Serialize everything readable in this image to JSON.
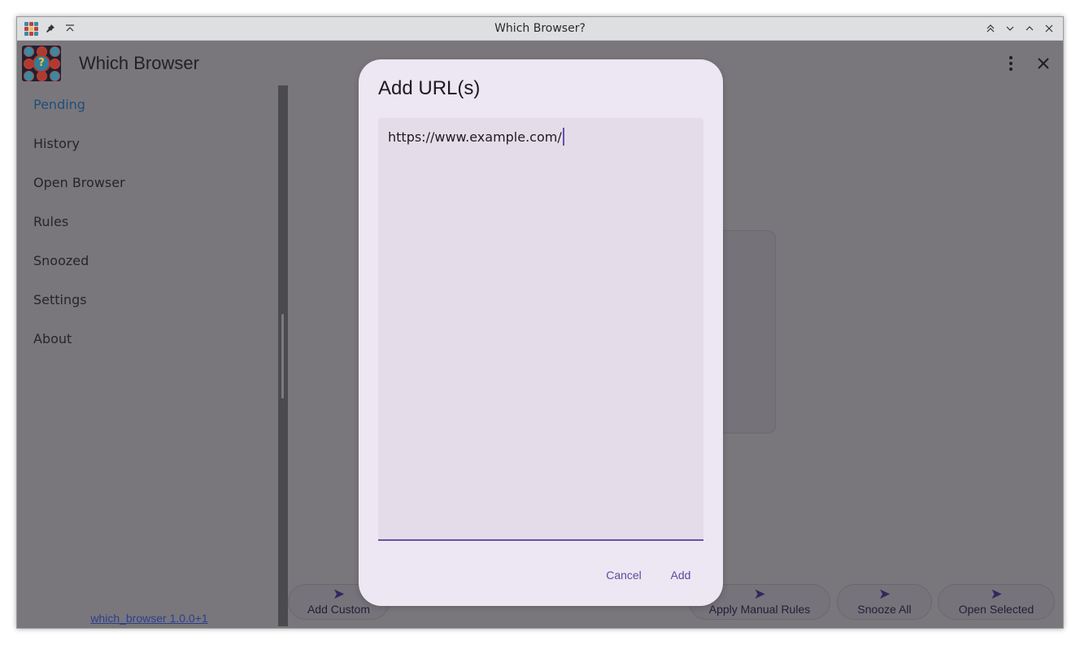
{
  "window": {
    "title": "Which Browser?"
  },
  "app": {
    "title": "Which Browser",
    "version": "which_browser 1.0.0+1"
  },
  "sidebar": {
    "items": [
      {
        "label": "Pending",
        "active": true
      },
      {
        "label": "History",
        "active": false
      },
      {
        "label": "Open Browser",
        "active": false
      },
      {
        "label": "Rules",
        "active": false
      },
      {
        "label": "Snoozed",
        "active": false
      },
      {
        "label": "Settings",
        "active": false
      },
      {
        "label": "About",
        "active": false
      }
    ]
  },
  "actions": {
    "add_custom": "Add Custom",
    "apply_manual_rules": "Apply Manual Rules",
    "snooze_all": "Snooze All",
    "open_selected": "Open Selected"
  },
  "dialog": {
    "title": "Add URL(s)",
    "url_value": "https://www.example.com/",
    "cancel_label": "Cancel",
    "add_label": "Add"
  },
  "icons": {
    "titlebar_left": [
      "app-icon",
      "pin-icon",
      "keep-above-icon"
    ],
    "titlebar_right": [
      "collapse-icon",
      "minimize-icon",
      "maximize-icon",
      "close-icon"
    ],
    "header_right": [
      "more-vert-icon",
      "close-icon"
    ],
    "action_buttons": "send-icon"
  },
  "colors": {
    "accent": "#6750a4",
    "active_nav": "#1f4f7a",
    "dialog_bg": "#ede6f3",
    "scrim": "#7a777c"
  }
}
